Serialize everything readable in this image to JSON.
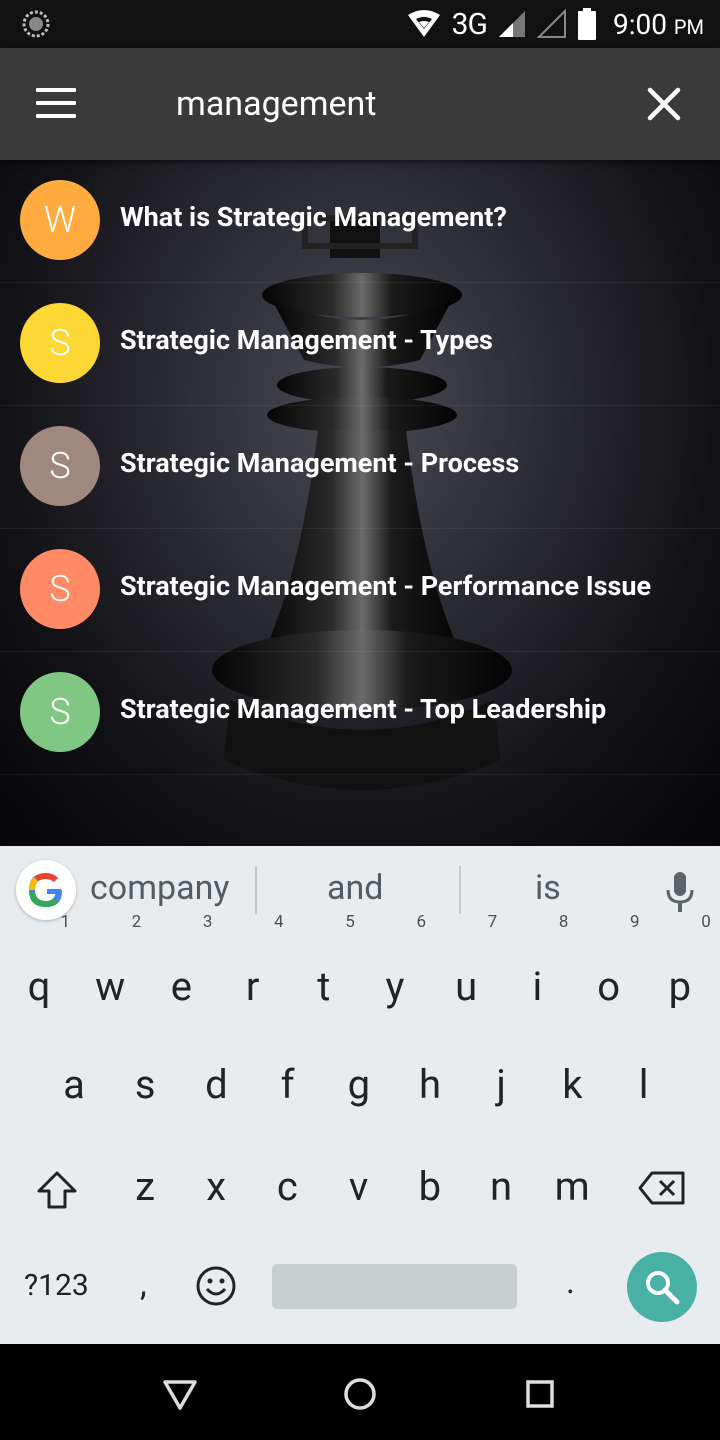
{
  "status_bar": {
    "network": "3G",
    "time": "9:00",
    "ampm": "PM",
    "icons": [
      "sync-icon",
      "wifi-icon",
      "signal-icon",
      "signal-empty-icon",
      "battery-icon"
    ]
  },
  "app_bar": {
    "search_value": "management",
    "menu_icon": "hamburger-icon",
    "close_icon": "close-icon"
  },
  "results": [
    {
      "letter": "W",
      "title": "What is Strategic Management?",
      "color": "#ffab40"
    },
    {
      "letter": "S",
      "title": "Strategic Management - Types",
      "color": "#fdd835"
    },
    {
      "letter": "S",
      "title": "Strategic Management - Process",
      "color": "#a1887f"
    },
    {
      "letter": "S",
      "title": "Strategic Management - Performance Issue",
      "color": "#ff8a65"
    },
    {
      "letter": "S",
      "title": "Strategic Management - Top Leadership",
      "color": "#81c784"
    }
  ],
  "keyboard": {
    "suggestions": [
      "company",
      "and",
      "is"
    ],
    "row1": [
      {
        "k": "q",
        "n": "1"
      },
      {
        "k": "w",
        "n": "2"
      },
      {
        "k": "e",
        "n": "3"
      },
      {
        "k": "r",
        "n": "4"
      },
      {
        "k": "t",
        "n": "5"
      },
      {
        "k": "y",
        "n": "6"
      },
      {
        "k": "u",
        "n": "7"
      },
      {
        "k": "i",
        "n": "8"
      },
      {
        "k": "o",
        "n": "9"
      },
      {
        "k": "p",
        "n": "0"
      }
    ],
    "row2": [
      "a",
      "s",
      "d",
      "f",
      "g",
      "h",
      "j",
      "k",
      "l"
    ],
    "row3": [
      "z",
      "x",
      "c",
      "v",
      "b",
      "n",
      "m"
    ],
    "symbols_label": "?123",
    "comma_label": ",",
    "period_label": ".",
    "accent_color": "#48b0a4"
  }
}
